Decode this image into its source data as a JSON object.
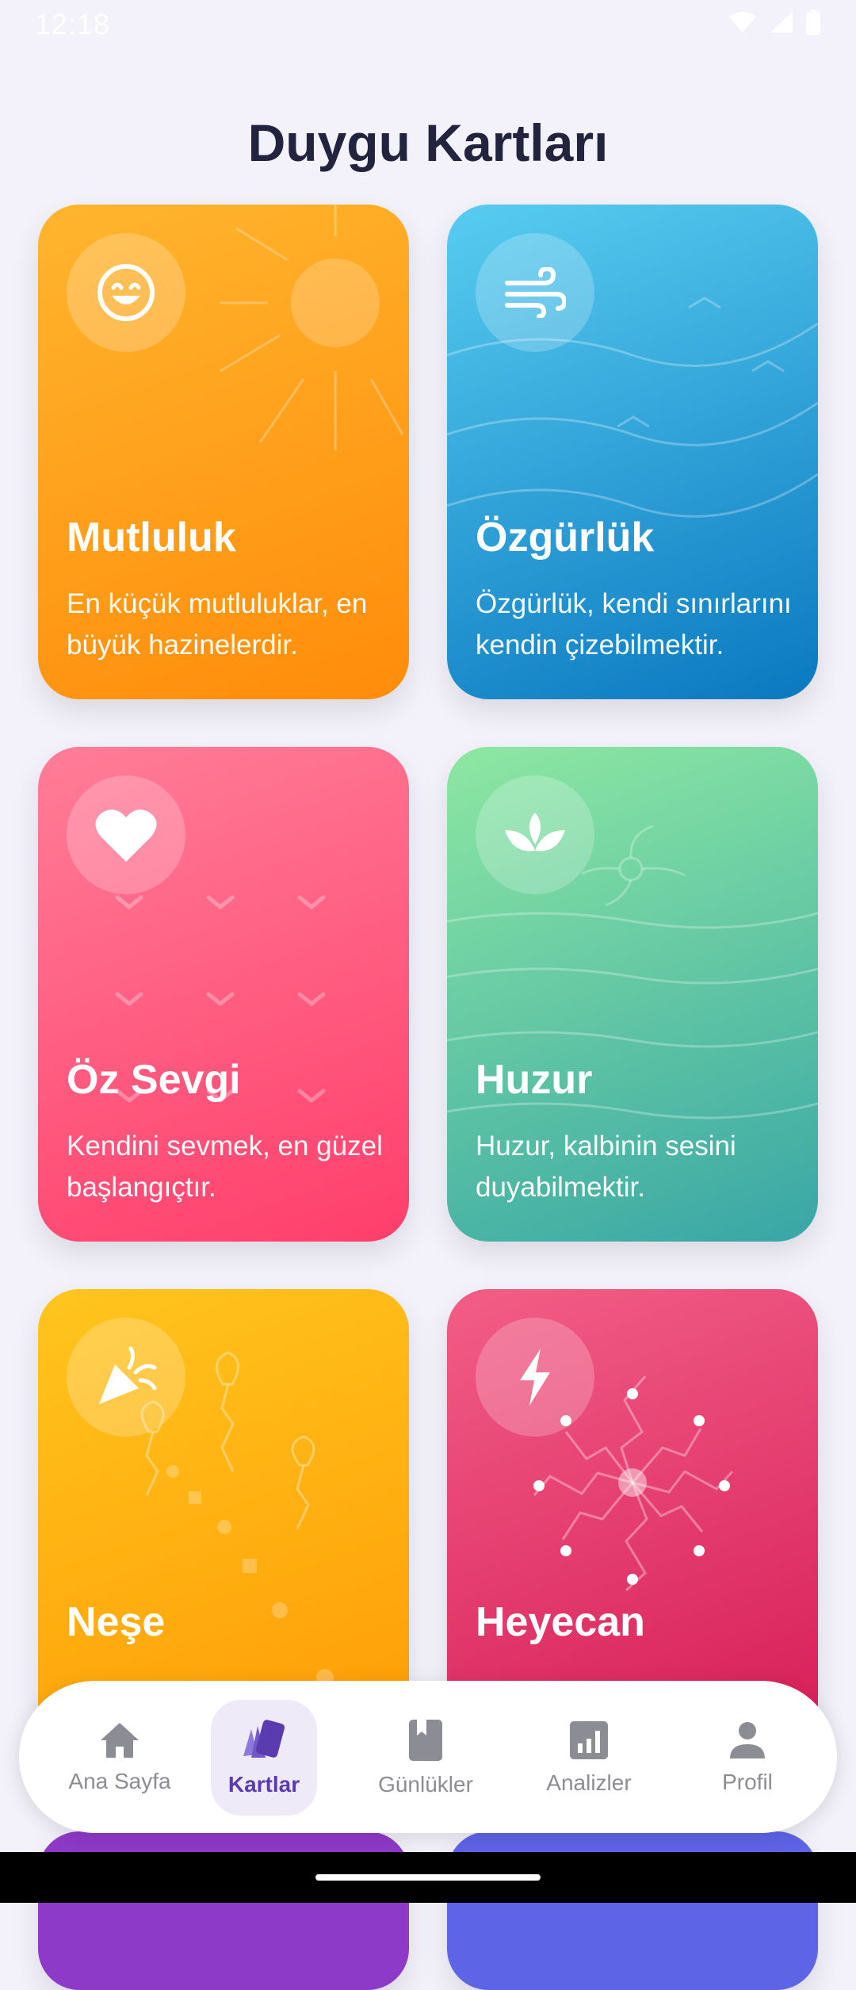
{
  "status_bar": {
    "time": "12:18"
  },
  "page": {
    "title": "Duygu Kartları"
  },
  "cards": [
    {
      "title": "Mutluluk",
      "description": "En küçük mutluluklar, en büyük hazinelerdir.",
      "icon": "smile-icon",
      "color": "#FF9A12"
    },
    {
      "title": "Özgürlük",
      "description": "Özgürlük, kendi sınırlarını kendin çizebilmektir.",
      "icon": "wind-icon",
      "color": "#1E9BD8"
    },
    {
      "title": "Öz Sevgi",
      "description": "Kendini sevmek, en güzel başlangıçtır.",
      "icon": "heart-icon",
      "color": "#FF5A80"
    },
    {
      "title": "Huzur",
      "description": "Huzur, kalbinin sesini duyabilmektir.",
      "icon": "lotus-icon",
      "color": "#5CC79C"
    },
    {
      "title": "Neşe",
      "description": "",
      "icon": "party-popper-icon",
      "color": "#FFB20F"
    },
    {
      "title": "Heyecan",
      "description": "",
      "icon": "lightning-icon",
      "color": "#E83B6C"
    }
  ],
  "bottom_nav": {
    "items": [
      {
        "label": "Ana Sayfa",
        "icon": "home-icon",
        "active": false
      },
      {
        "label": "Kartlar",
        "icon": "cards-icon",
        "active": true
      },
      {
        "label": "Günlükler",
        "icon": "book-icon",
        "active": false
      },
      {
        "label": "Analizler",
        "icon": "analytics-icon",
        "active": false
      },
      {
        "label": "Profil",
        "icon": "person-icon",
        "active": false
      }
    ]
  }
}
